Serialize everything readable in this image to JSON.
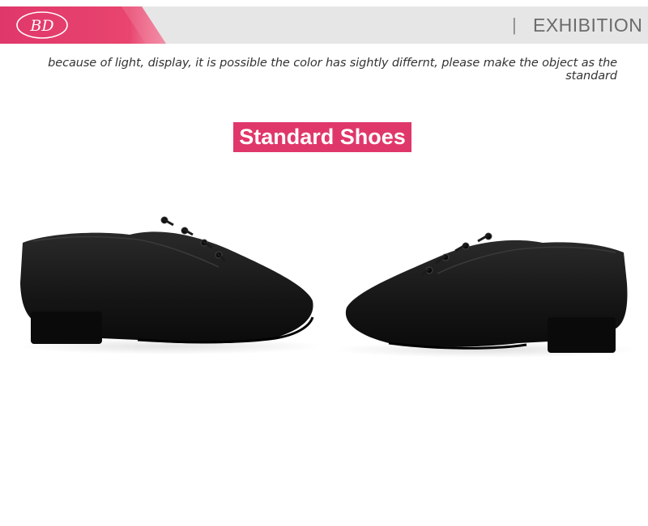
{
  "header": {
    "logo_text": "BD",
    "section_title": "EXHIBITION",
    "separator": "|",
    "colors": {
      "accent": "#e0376a",
      "bar": "#e6e6e6"
    }
  },
  "notice": "because of light, display,  it is possible the color has sightly differnt, please make  the object as the standard",
  "section": {
    "title": "Standard Shoes"
  },
  "images": [
    {
      "name": "shoe-left-view",
      "color": "#111111"
    },
    {
      "name": "shoe-right-view",
      "color": "#111111"
    }
  ]
}
